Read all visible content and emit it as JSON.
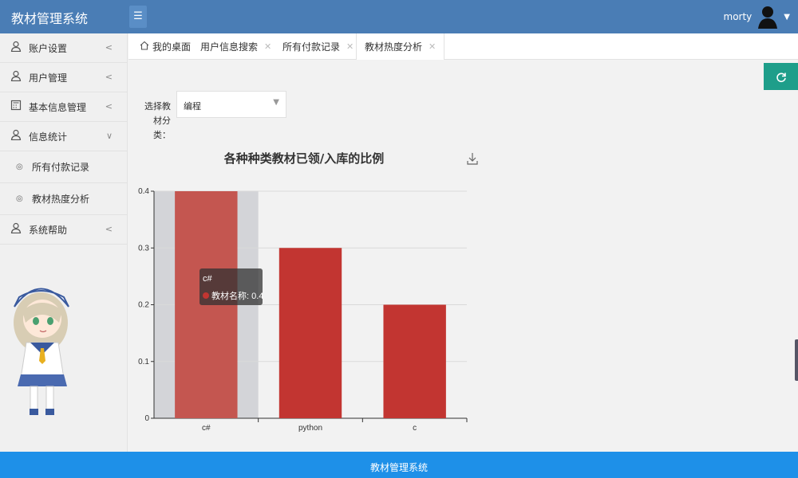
{
  "header": {
    "app_title": "教材管理系统",
    "user_name": "morty"
  },
  "sidebar": {
    "items": [
      {
        "label": "账户设置"
      },
      {
        "label": "用户管理"
      },
      {
        "label": "基本信息管理"
      },
      {
        "label": "信息统计"
      },
      {
        "label": "所有付款记录"
      },
      {
        "label": "教材热度分析"
      },
      {
        "label": "系统帮助"
      }
    ]
  },
  "tabs": [
    {
      "label": "我的桌面"
    },
    {
      "label": "用户信息搜索"
    },
    {
      "label": "所有付款记录"
    },
    {
      "label": "教材热度分析"
    }
  ],
  "filter": {
    "label": "选择教材分类：",
    "selected": "编程"
  },
  "tooltip": {
    "title": "c#",
    "label": "教材名称: 0.4"
  },
  "chart_data": {
    "type": "bar",
    "title": "各种种类教材已领/入库的比例",
    "categories": [
      "c#",
      "python",
      "c"
    ],
    "values": [
      0.4,
      0.3,
      0.2
    ],
    "ylim": [
      0,
      0.4
    ],
    "yticks": [
      "0",
      "0.1",
      "0.2",
      "0.3",
      "0.4"
    ],
    "grid": true,
    "bar_color": "#c23531",
    "highlight_color": "#c45650",
    "hover_index": 0
  },
  "footer": {
    "text": "教材管理系统"
  },
  "colors": {
    "header": "#4a7db5",
    "footer": "#1e90e8",
    "refresh": "#1e9e8a"
  }
}
